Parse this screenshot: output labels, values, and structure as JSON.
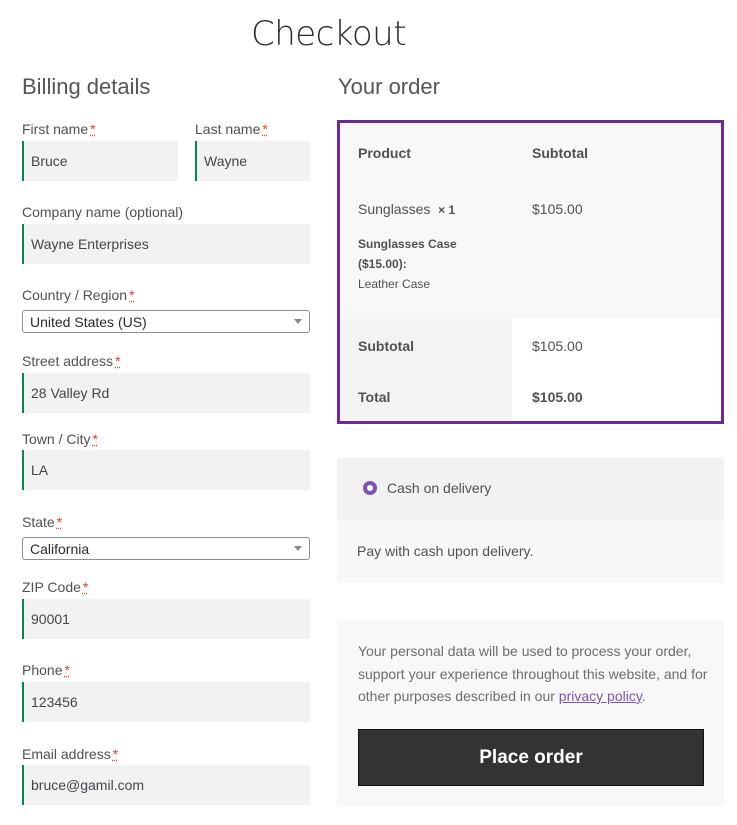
{
  "page": {
    "title": "Checkout"
  },
  "billing": {
    "heading": "Billing details",
    "required_mark": "*",
    "first_name": {
      "label": "First name",
      "value": "Bruce"
    },
    "last_name": {
      "label": "Last name",
      "value": "Wayne"
    },
    "company": {
      "label": "Company name (optional)",
      "value": "Wayne Enterprises"
    },
    "country": {
      "label": "Country / Region",
      "value": "United States (US)"
    },
    "street": {
      "label": "Street address",
      "value": "28 Valley Rd"
    },
    "city": {
      "label": "Town / City",
      "value": "LA"
    },
    "state": {
      "label": "State",
      "value": "California"
    },
    "zip": {
      "label": "ZIP Code",
      "value": "90001"
    },
    "phone": {
      "label": "Phone",
      "value": "123456"
    },
    "email": {
      "label": "Email address",
      "value": "bruce@gamil.com"
    }
  },
  "order": {
    "heading": "Your order",
    "col_product": "Product",
    "col_subtotal": "Subtotal",
    "item": {
      "name": "Sunglasses",
      "qty": "× 1",
      "price": "$105.00",
      "addon_line1": "Sunglasses Case",
      "addon_line2": "($15.00):",
      "addon_value": "Leather Case"
    },
    "subtotal_label": "Subtotal",
    "subtotal_value": "$105.00",
    "total_label": "Total",
    "total_value": "$105.00"
  },
  "payment": {
    "method": "Cash on delivery",
    "description": "Pay with cash upon delivery."
  },
  "privacy": {
    "text_line1": "Your personal data will be used to process your order,",
    "text_line2": "support your experience throughout this website, and for",
    "text_line3_pre": "other purposes described in our ",
    "link": "privacy policy",
    "text_line3_post": "."
  },
  "place_order_label": "Place order",
  "colors": {
    "accent": "#7f54b3",
    "order_border": "#6c2c93",
    "input_border": "#0f834d",
    "required": "#e2401c",
    "button_bg": "#333333"
  }
}
